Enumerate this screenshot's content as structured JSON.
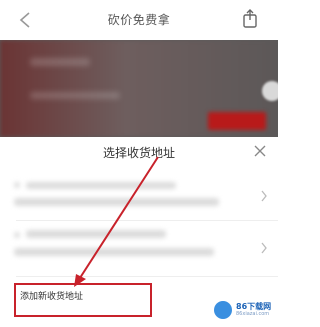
{
  "navbar": {
    "title": "砍价免费拿",
    "back_icon": "back-arrow-icon",
    "share_icon": "share-icon"
  },
  "sheet": {
    "title": "选择收货地址",
    "close_icon": "close-icon",
    "add_address_label": "添加新收货地址"
  },
  "annotation": {
    "color": "#c8222b"
  },
  "watermark": {
    "brand": "86下载网",
    "subtext": "86xiazai.com"
  }
}
